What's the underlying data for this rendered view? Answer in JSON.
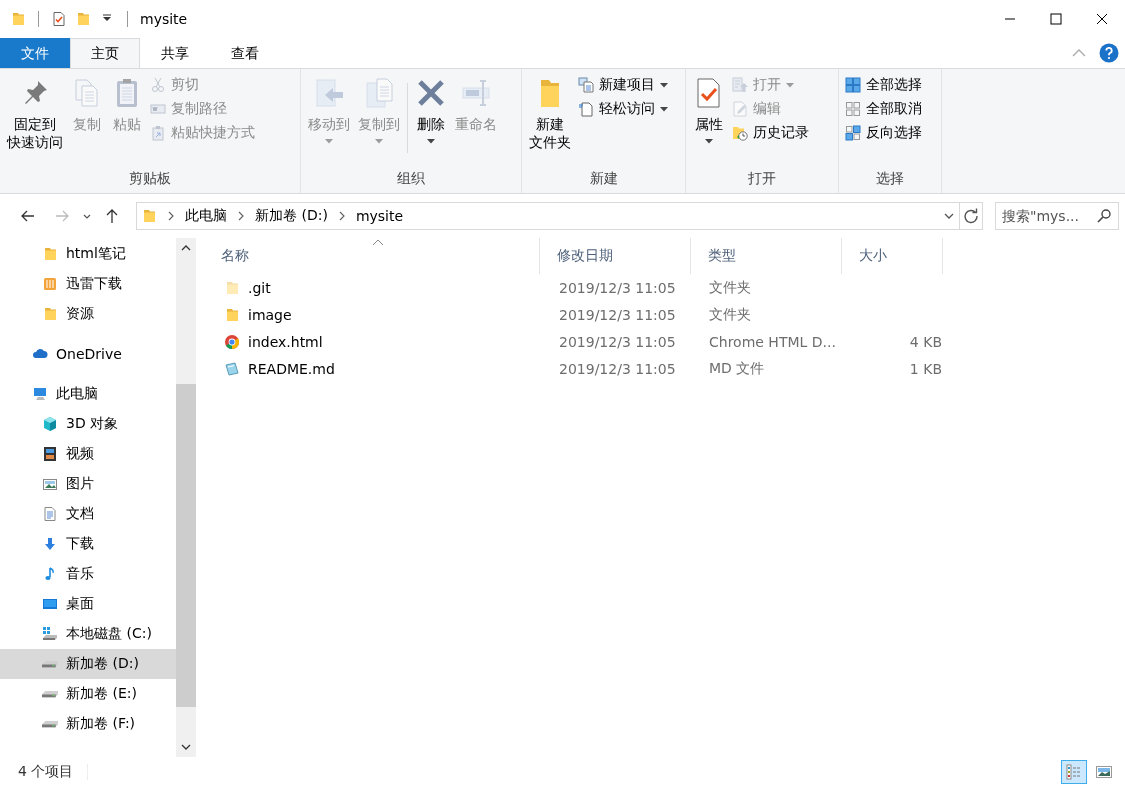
{
  "window": {
    "title": "mysite"
  },
  "tabs": [
    {
      "label": "文件",
      "kind": "file",
      "selected": false
    },
    {
      "label": "主页",
      "kind": "tab",
      "selected": true
    },
    {
      "label": "共享",
      "kind": "tab",
      "selected": false
    },
    {
      "label": "查看",
      "kind": "tab",
      "selected": false
    }
  ],
  "ribbon": {
    "groups": [
      {
        "label": "剪贴板",
        "items": [
          {
            "label": [
              "固定到",
              "快速访问"
            ],
            "kind": "large",
            "disabled": false,
            "menu": false
          },
          {
            "label": [
              "复制"
            ],
            "kind": "large",
            "disabled": true,
            "menu": false
          },
          {
            "label": [
              "粘贴"
            ],
            "kind": "large",
            "disabled": true,
            "menu": false
          },
          {
            "label": "剪切",
            "kind": "small",
            "disabled": true,
            "menu": false
          },
          {
            "label": "复制路径",
            "kind": "small",
            "disabled": true,
            "menu": false
          },
          {
            "label": "粘贴快捷方式",
            "kind": "small",
            "disabled": true,
            "menu": false
          }
        ]
      },
      {
        "label": "组织",
        "items": [
          {
            "label": [
              "移动到"
            ],
            "kind": "large",
            "disabled": true,
            "menu": true
          },
          {
            "label": [
              "复制到"
            ],
            "kind": "large",
            "disabled": true,
            "menu": true
          },
          {
            "label": [
              "删除"
            ],
            "kind": "large",
            "disabled": false,
            "menu": true
          },
          {
            "label": [
              "重命名"
            ],
            "kind": "large",
            "disabled": true,
            "menu": false
          }
        ]
      },
      {
        "label": "新建",
        "items": [
          {
            "label": [
              "新建",
              "文件夹"
            ],
            "kind": "large",
            "disabled": false,
            "menu": false
          },
          {
            "label": "新建项目",
            "kind": "small",
            "disabled": false,
            "menu": true
          },
          {
            "label": "轻松访问",
            "kind": "small",
            "disabled": false,
            "menu": true
          }
        ]
      },
      {
        "label": "打开",
        "items": [
          {
            "label": [
              "属性"
            ],
            "kind": "large",
            "disabled": false,
            "menu": true
          },
          {
            "label": "打开",
            "kind": "small",
            "disabled": true,
            "menu": true
          },
          {
            "label": "编辑",
            "kind": "small",
            "disabled": true,
            "menu": false
          },
          {
            "label": "历史记录",
            "kind": "small",
            "disabled": false,
            "menu": false
          }
        ]
      },
      {
        "label": "选择",
        "items": [
          {
            "label": "全部选择",
            "kind": "small",
            "disabled": false,
            "menu": false
          },
          {
            "label": "全部取消",
            "kind": "small",
            "disabled": false,
            "menu": false
          },
          {
            "label": "反向选择",
            "kind": "small",
            "disabled": false,
            "menu": false
          }
        ]
      }
    ]
  },
  "address": {
    "breadcrumbs": [
      "此电脑",
      "新加卷 (D:)",
      "mysite"
    ]
  },
  "search": {
    "placeholder": "搜索\"mys..."
  },
  "nav": {
    "pinned": [
      {
        "label": "html笔记",
        "selected": false
      },
      {
        "label": "迅雷下载",
        "selected": false
      },
      {
        "label": "资源",
        "selected": false
      }
    ],
    "roots": [
      {
        "label": "OneDrive",
        "selected": false
      },
      {
        "label": "此电脑",
        "selected": false,
        "children": [
          {
            "label": "3D 对象",
            "selected": false
          },
          {
            "label": "视频",
            "selected": false
          },
          {
            "label": "图片",
            "selected": false
          },
          {
            "label": "文档",
            "selected": false
          },
          {
            "label": "下载",
            "selected": false
          },
          {
            "label": "音乐",
            "selected": false
          },
          {
            "label": "桌面",
            "selected": false
          },
          {
            "label": "本地磁盘 (C:)",
            "selected": false
          },
          {
            "label": "新加卷 (D:)",
            "selected": true
          },
          {
            "label": "新加卷 (E:)",
            "selected": false
          },
          {
            "label": "新加卷 (F:)",
            "selected": false
          }
        ]
      }
    ]
  },
  "files": {
    "columns": [
      "名称",
      "修改日期",
      "类型",
      "大小"
    ],
    "rows": [
      {
        "name": ".git",
        "kind": "folder",
        "hidden": true,
        "date": "2019/12/3 11:05",
        "type": "文件夹"
      },
      {
        "name": "image",
        "kind": "folder",
        "hidden": false,
        "date": "2019/12/3 11:05",
        "type": "文件夹"
      },
      {
        "name": "index.html",
        "kind": "chrome",
        "hidden": false,
        "date": "2019/12/3 11:05",
        "type": "Chrome HTML D...",
        "size": "4 KB"
      },
      {
        "name": "README.md",
        "kind": "md",
        "hidden": false,
        "date": "2019/12/3 11:05",
        "type": "MD 文件",
        "size": "1 KB"
      }
    ]
  },
  "status_bar": {
    "text": "4 个项目",
    "views": [
      {
        "selected": true
      },
      {
        "selected": false
      }
    ]
  }
}
